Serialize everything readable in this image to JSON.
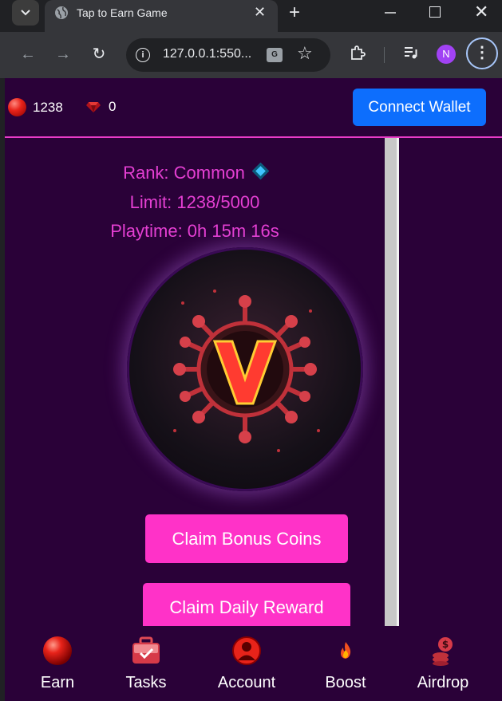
{
  "browser": {
    "tab_title": "Tap to Earn Game",
    "url": "127.0.0.1:550...",
    "profile_initial": "N"
  },
  "header": {
    "coin_count": "1238",
    "gem_count": "0",
    "connect_wallet_label": "Connect Wallet"
  },
  "status": {
    "rank": "Rank: Common",
    "limit": "Limit: 1238/5000",
    "playtime": "Playtime: 0h 15m 16s"
  },
  "buttons": {
    "claim_bonus": "Claim Bonus Coins",
    "claim_daily": "Claim Daily Reward"
  },
  "nav": [
    {
      "label": "Earn",
      "icon": "red-orb-icon"
    },
    {
      "label": "Tasks",
      "icon": "briefcase-icon"
    },
    {
      "label": "Account",
      "icon": "user-icon"
    },
    {
      "label": "Boost",
      "icon": "fire-icon"
    },
    {
      "label": "Airdrop",
      "icon": "coins-icon"
    }
  ],
  "colors": {
    "page_bg": "#2a0138",
    "accent_pink": "#ff32c8",
    "text_magenta": "#e53fd3",
    "wallet_blue": "#0d6efd"
  }
}
